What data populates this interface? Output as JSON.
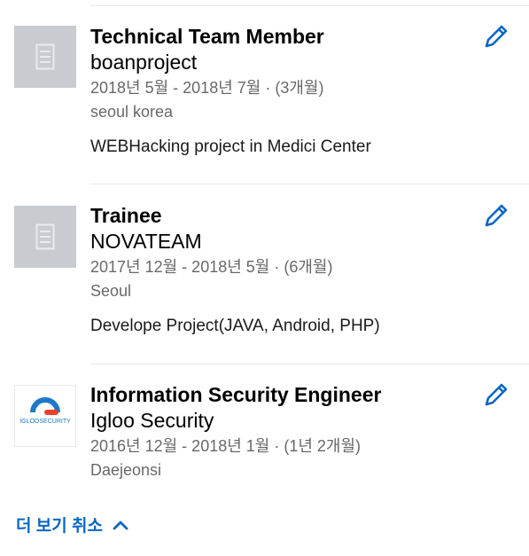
{
  "experiences": [
    {
      "title": "Technical Team Member",
      "company": "boanproject",
      "dates": "2018년 5월 - 2018년 7월 · (3개월)",
      "location": "seoul korea",
      "description": "WEBHacking project in Medici Center",
      "logo": "building-placeholder-icon"
    },
    {
      "title": "Trainee",
      "company": "NOVATEAM",
      "dates": "2017년 12월 - 2018년 5월 · (6개월)",
      "location": "Seoul",
      "description": "Develope Project(JAVA, Android, PHP)",
      "logo": "building-placeholder-icon"
    },
    {
      "title": "Information Security Engineer",
      "company": "Igloo Security",
      "dates": "2016년 12월 - 2018년 1월 · (1년 2개월)",
      "location": "Daejeonsi",
      "logo_text": "IGLOOSECURITY",
      "logo": "igloo-security-logo"
    }
  ],
  "show_less_label": "더 보기 취소",
  "colors": {
    "accent": "#0a66c2",
    "placeholder_bg": "#c8ccd0",
    "divider": "#e6e9ec",
    "secondary_text": "#666666",
    "igloo_orange": "#e8412c",
    "igloo_blue": "#1e78c8"
  },
  "icons": {
    "edit": "pencil-icon",
    "collapse": "chevron-up-icon"
  }
}
